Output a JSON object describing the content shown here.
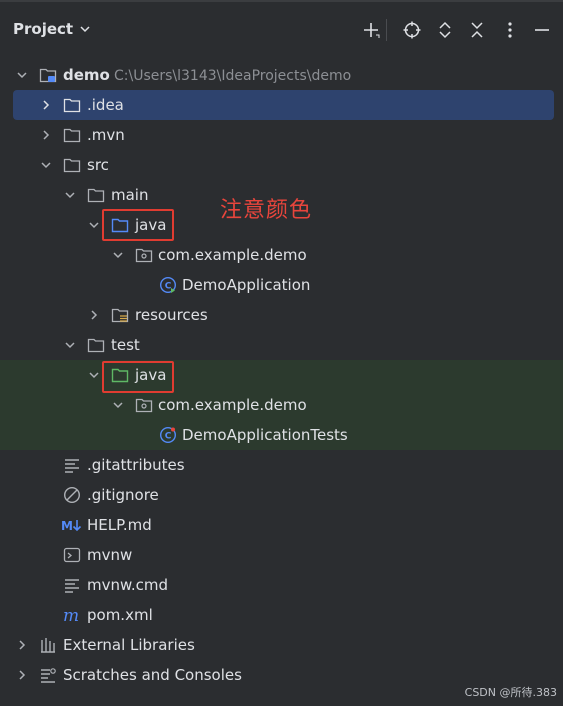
{
  "header": {
    "title": "Project",
    "toolbar": [
      "add-icon",
      "locate-icon",
      "expand-all-icon",
      "collapse-all-icon",
      "more-icon",
      "minimize-icon"
    ]
  },
  "tree": {
    "root_label": "demo",
    "root_path": "C:\\Users\\l3143\\IdeaProjects\\demo",
    "idea": ".idea",
    "mvn": ".mvn",
    "src": "src",
    "main": "main",
    "main_java": "java",
    "main_pkg": "com.example.demo",
    "main_class": "DemoApplication",
    "resources": "resources",
    "test": "test",
    "test_java": "java",
    "test_pkg": "com.example.demo",
    "test_class": "DemoApplicationTests",
    "gitattributes": ".gitattributes",
    "gitignore": ".gitignore",
    "help": "HELP.md",
    "mvnw": "mvnw",
    "mvnw_cmd": "mvnw.cmd",
    "pom": "pom.xml",
    "ext_libs": "External Libraries",
    "scratches": "Scratches and Consoles"
  },
  "annotation": "注意颜色",
  "watermark": "CSDN @所待.383",
  "colors": {
    "background": "#2b2d30",
    "selection": "#2e436e",
    "test_highlight": "#2c3a2e",
    "source_folder": "#548af7",
    "test_folder": "#5fb865",
    "annotation": "#e03c31"
  }
}
